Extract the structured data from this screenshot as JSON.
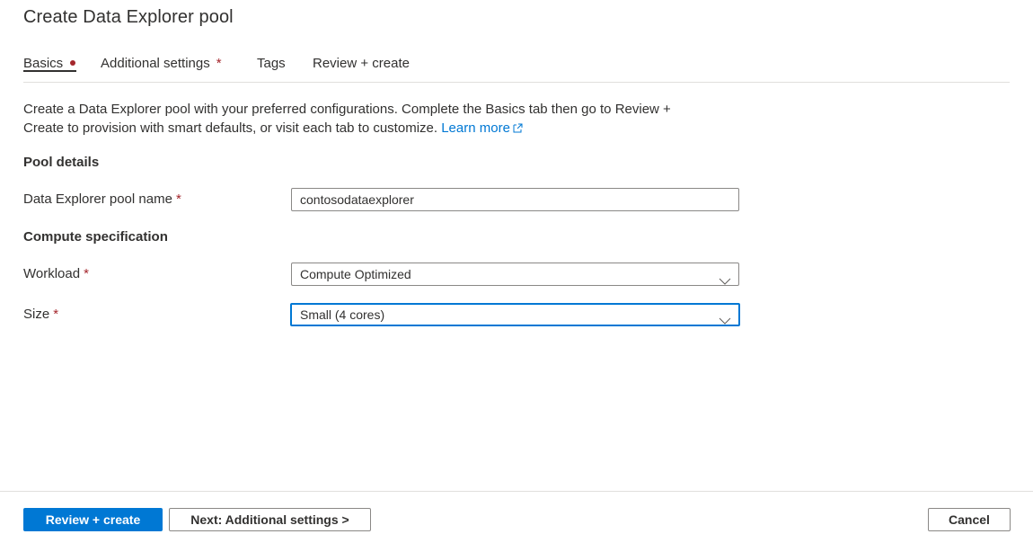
{
  "page": {
    "title": "Create Data Explorer pool"
  },
  "tabs": [
    {
      "label": "Basics",
      "marker": "dot"
    },
    {
      "label": "Additional settings",
      "marker": "*"
    },
    {
      "label": "Tags"
    },
    {
      "label": "Review + create"
    }
  ],
  "intro": {
    "text_line1": "Create a Data Explorer pool with your preferred configurations. Complete the Basics tab then go to Review +",
    "text_line2": "Create to provision with smart defaults, or visit each tab to customize.",
    "link_label": "Learn more"
  },
  "pool_details": {
    "heading": "Pool details",
    "pool_name_label": "Data Explorer pool name",
    "pool_name_value": "contosodataexplorer"
  },
  "compute": {
    "heading": "Compute specification",
    "workload_label": "Workload",
    "workload_value": "Compute Optimized",
    "size_label": "Size",
    "size_value": "Small (4 cores)"
  },
  "required_marker": "*",
  "footer": {
    "review_create": "Review + create",
    "next": "Next: Additional settings >",
    "cancel": "Cancel"
  },
  "colors": {
    "accent": "#0078d4",
    "required": "#a4262c",
    "text": "#323130",
    "border": "#8a8886"
  }
}
